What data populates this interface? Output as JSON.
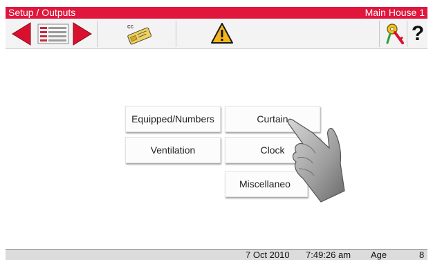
{
  "title_bar": {
    "breadcrumb": "Setup / Outputs",
    "location": "Main House 1"
  },
  "toolbar": {
    "back_icon": "left-arrow-icon",
    "list_icon": "list-view-icon",
    "forward_icon": "right-arrow-icon",
    "cc_icon": "cc-card-icon",
    "cc_label": "cc",
    "warning_icon": "warning-icon",
    "key_icon": "key-icon",
    "help_label": "?"
  },
  "menu": {
    "equipped_numbers": "Equipped/Numbers",
    "curtain": "Curtain",
    "ventilation": "Ventilation",
    "clock": "Clock",
    "miscellaneous": "Miscellaneo"
  },
  "status_bar": {
    "date": "7 Oct 2010",
    "time": "7:49:26 am",
    "age_label": "Age",
    "age_value": "8"
  },
  "colors": {
    "accent": "#e0163c",
    "toolbar": "#f3f3f3"
  }
}
